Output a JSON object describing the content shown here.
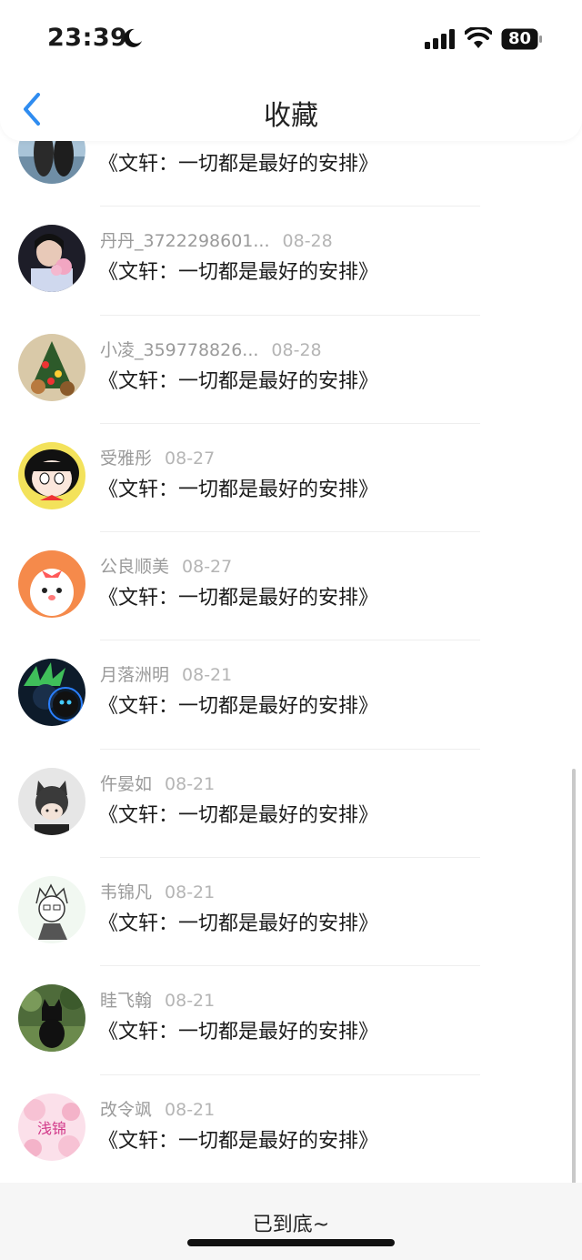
{
  "status_bar": {
    "time": "23:39",
    "battery_level": "80",
    "icons": [
      "moon-icon",
      "signal-icon",
      "wifi-icon",
      "battery-icon"
    ]
  },
  "nav": {
    "title": "收藏",
    "back_icon": "chevron-left-icon",
    "accent_color": "#2f8cf0"
  },
  "items": [
    {
      "name": "",
      "date": "",
      "book": "《文轩：一切都是最好的安排》"
    },
    {
      "name": "丹丹_3722298601...",
      "date": "08-28",
      "book": "《文轩：一切都是最好的安排》"
    },
    {
      "name": "小凌_359778826...",
      "date": "08-28",
      "book": "《文轩：一切都是最好的安排》"
    },
    {
      "name": "受雅彤",
      "date": "08-27",
      "book": "《文轩：一切都是最好的安排》"
    },
    {
      "name": "公良顺美",
      "date": "08-27",
      "book": "《文轩：一切都是最好的安排》"
    },
    {
      "name": "月落洲明",
      "date": "08-21",
      "book": "《文轩：一切都是最好的安排》"
    },
    {
      "name": "仵晏如",
      "date": "08-21",
      "book": "《文轩：一切都是最好的安排》"
    },
    {
      "name": "韦锦凡",
      "date": "08-21",
      "book": "《文轩：一切都是最好的安排》"
    },
    {
      "name": "眭飞翰",
      "date": "08-21",
      "book": "《文轩：一切都是最好的安排》"
    },
    {
      "name": "改令飒",
      "date": "08-21",
      "book": "《文轩：一切都是最好的安排》"
    }
  ],
  "avatar_badge_text": "浅锦",
  "footer": {
    "end_text": "已到底~"
  }
}
